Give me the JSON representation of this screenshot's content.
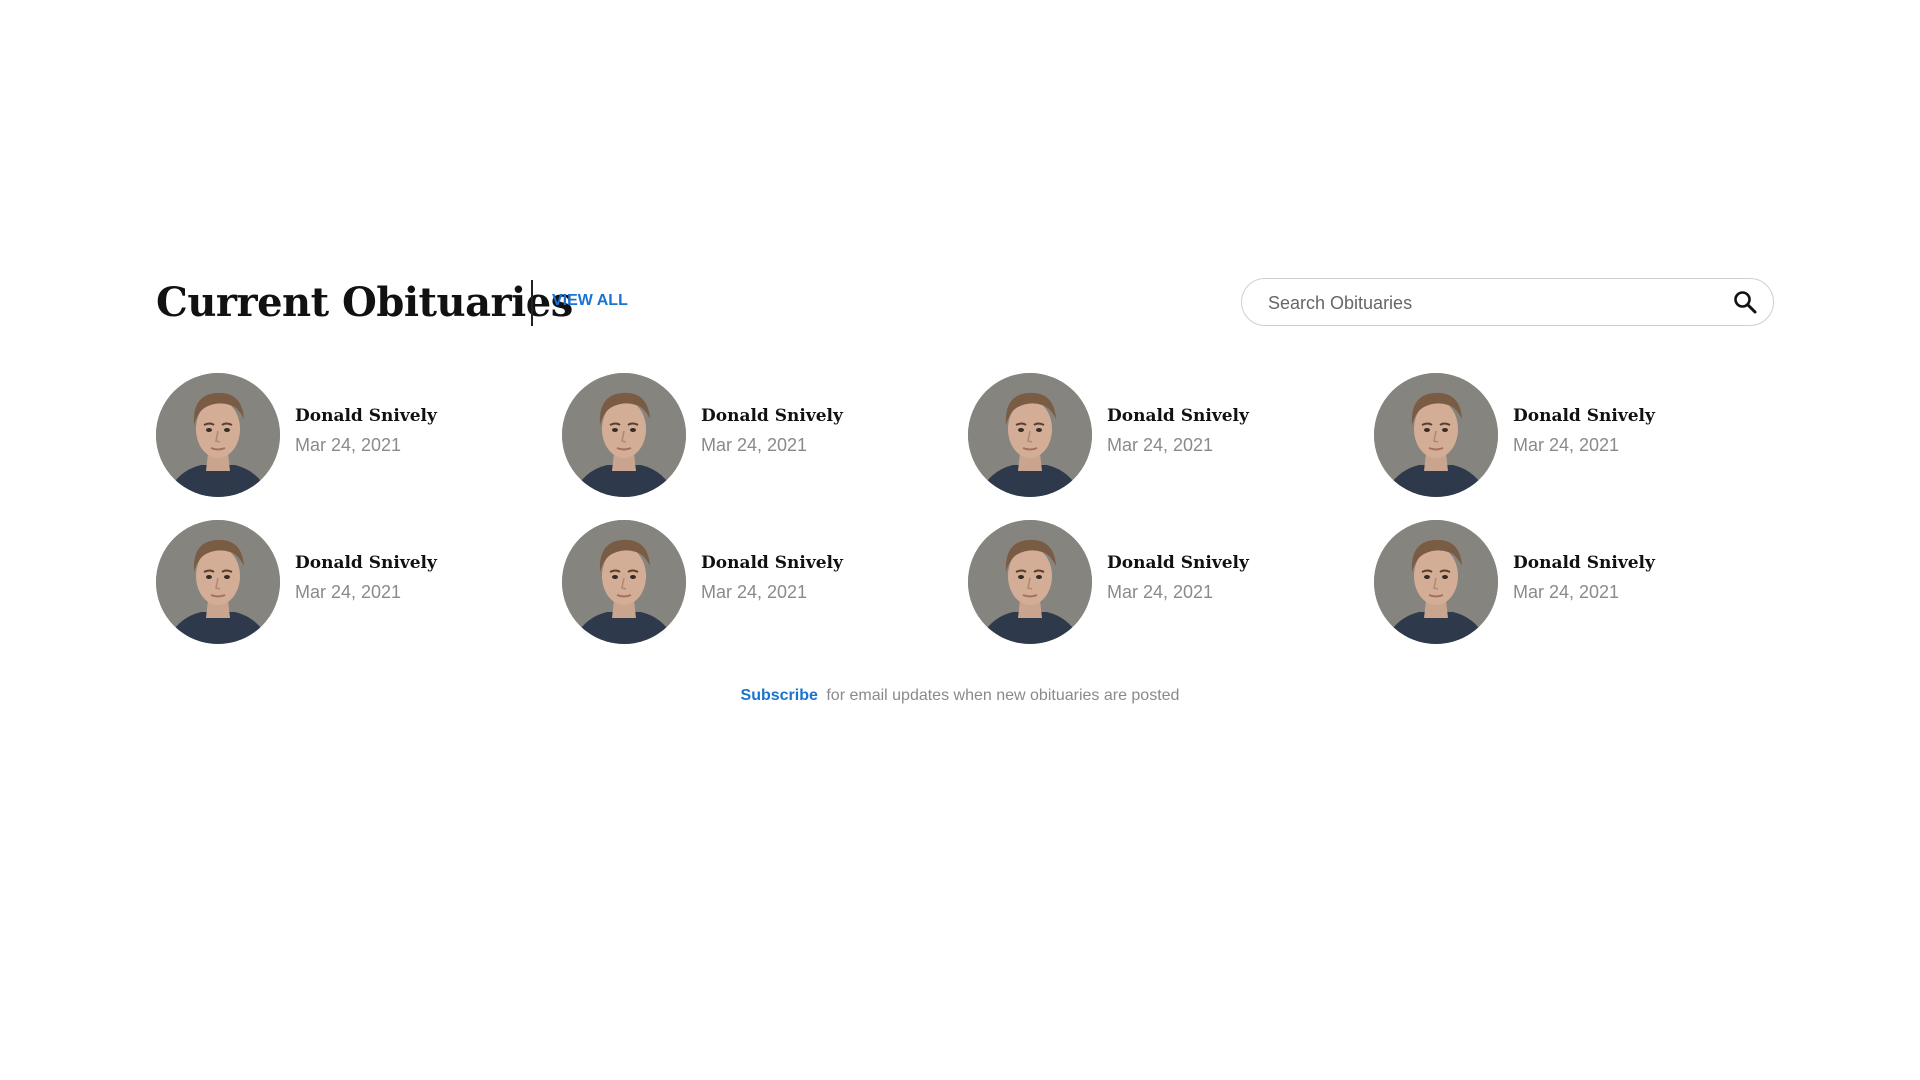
{
  "header": {
    "title": "Current Obituaries",
    "view_all_label": "VIEW ALL"
  },
  "search": {
    "placeholder": "Search Obituaries",
    "value": "",
    "icon": "search-icon"
  },
  "obituaries": [
    {
      "name": "Donald Snively",
      "date": "Mar 24, 2021"
    },
    {
      "name": "Donald Snively",
      "date": "Mar 24, 2021"
    },
    {
      "name": "Donald Snively",
      "date": "Mar 24, 2021"
    },
    {
      "name": "Donald Snively",
      "date": "Mar 24, 2021"
    },
    {
      "name": "Donald Snively",
      "date": "Mar 24, 2021"
    },
    {
      "name": "Donald Snively",
      "date": "Mar 24, 2021"
    },
    {
      "name": "Donald Snively",
      "date": "Mar 24, 2021"
    },
    {
      "name": "Donald Snively",
      "date": "Mar 24, 2021"
    }
  ],
  "subscribe": {
    "link_label": "Subscribe",
    "text": "for email updates when new obituaries are posted"
  },
  "colors": {
    "accent": "#1a73d1",
    "title": "#111111",
    "muted": "#8a8a8a",
    "border": "#cfcfcf"
  }
}
